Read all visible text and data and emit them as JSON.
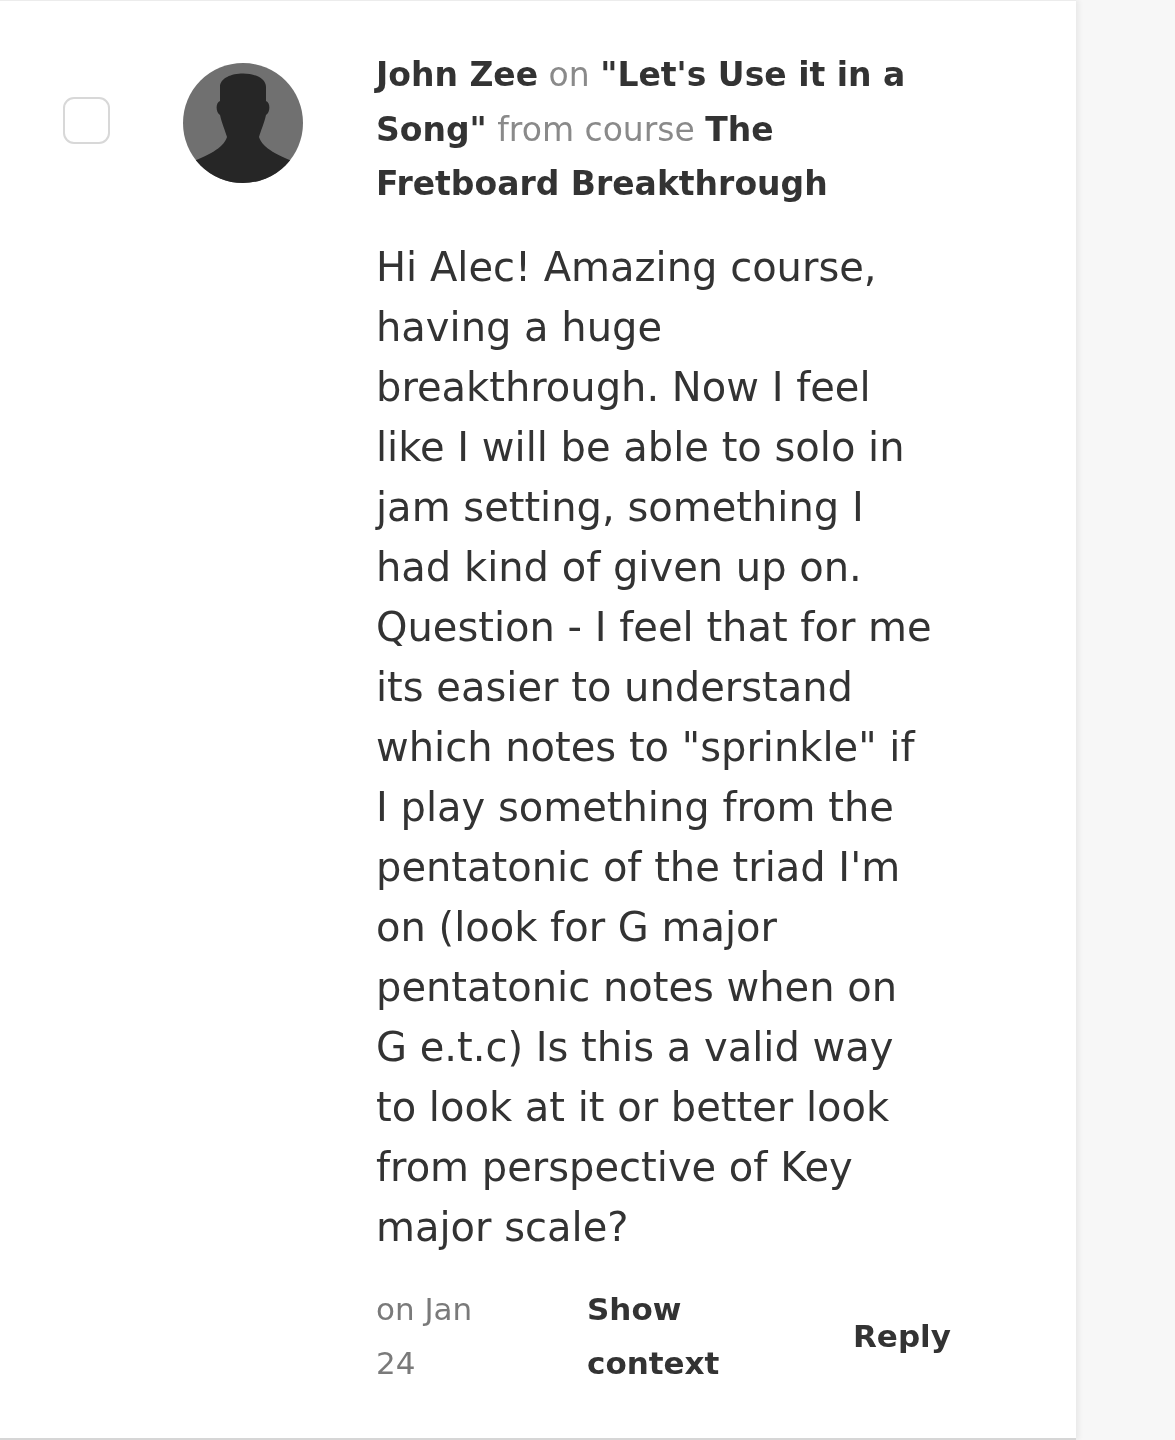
{
  "comment": {
    "checked": false,
    "header": "**John Zee** on **\"Let's Use it in a Song\"** from course **The Fretboard Breakthrough**",
    "body": "Hi Alec! Amazing course, having a huge breakthrough. Now I feel like I will be able to solo in jam setting, something I had kind of given up on. Question - I feel that for me its easier to understand which notes to \"sprinkle\" if I play something from the pentatonic of the triad I'm on (look for G major pentatonic notes when on G e.t.c) Is this a valid way to look at it or better look from perspective of Key major scale?",
    "date": "on Jan 24",
    "actions": [
      {
        "kind": "link",
        "label": "Show context"
      },
      {
        "kind": "button",
        "label": "Reply"
      }
    ]
  }
}
